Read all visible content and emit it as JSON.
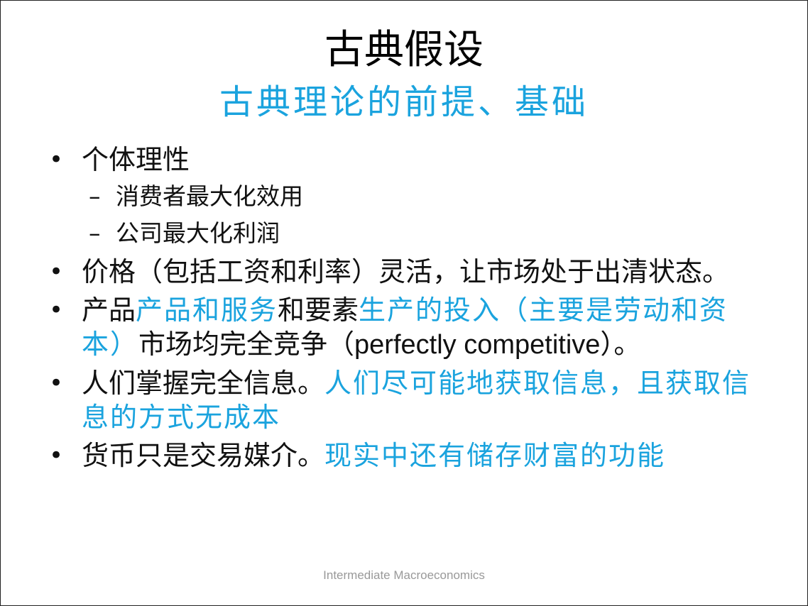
{
  "slide": {
    "title": "古典假设",
    "subtitle": "古典理论的前提、基础",
    "bullets": [
      {
        "text": "个体理性",
        "sub": [
          "消费者最大化效用",
          "公司最大化利润"
        ]
      },
      {
        "text": "价格（包括工资和利率）灵活，让市场处于出清状态。"
      },
      {
        "parts": [
          {
            "text": "产品",
            "highlight": false
          },
          {
            "text": "产品和服务",
            "highlight": true
          },
          {
            "text": "和要素",
            "highlight": false
          },
          {
            "text": "生产的投入（主要是劳动和资本）",
            "highlight": true
          },
          {
            "text": "市场均完全竞争（",
            "highlight": false
          },
          {
            "text": "perfectly competitive",
            "highlight": false
          },
          {
            "text": "）。",
            "highlight": false
          }
        ]
      },
      {
        "parts": [
          {
            "text": "人们掌握完全信息。",
            "highlight": false
          },
          {
            "text": "人们尽可能地获取信息，且获取信息的方式无成本",
            "highlight": true
          }
        ]
      },
      {
        "parts": [
          {
            "text": "货币只是交易媒介。",
            "highlight": false
          },
          {
            "text": "现实中还有储存财富的功能",
            "highlight": true
          }
        ]
      }
    ],
    "bullet_symbol": "•",
    "sub_bullet_symbol": "–",
    "footer": "Intermediate Macroeconomics"
  },
  "colors": {
    "highlight": "#1aa3de",
    "footer": "#999999",
    "text": "#111111"
  }
}
